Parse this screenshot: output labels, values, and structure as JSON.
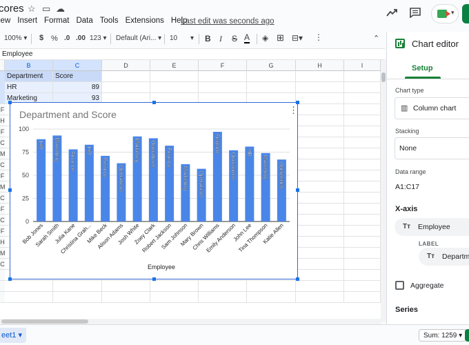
{
  "titlebar": {
    "doc_title": "cores",
    "star_icon": "☆",
    "move_icon": "▭",
    "cloud_icon": "☁"
  },
  "menu": [
    "View",
    "Insert",
    "Format",
    "Data",
    "Tools",
    "Extensions",
    "Help"
  ],
  "menu_first_text": "iew",
  "last_edit": "Last edit was seconds ago",
  "toolbar": {
    "zoom": "100%",
    "currency": "$",
    "percent": "%",
    "dec_decrease": ".0",
    "dec_increase": ".00",
    "number_format": "123",
    "font": "Default (Ari...",
    "font_size": "10",
    "bold": "B",
    "italic": "I",
    "strike": "S",
    "text_color": "A"
  },
  "formula_bar": {
    "content": "Employee"
  },
  "grid": {
    "columns": [
      "B",
      "C",
      "D",
      "E",
      "F",
      "G",
      "H",
      "I"
    ],
    "row_letters": [
      "F",
      "H",
      "F",
      "C",
      "M",
      "C",
      "F",
      "M",
      "C",
      "F",
      "C",
      "F",
      "H",
      "M",
      "C"
    ],
    "rows": [
      {
        "department": "Department",
        "score": "Score"
      },
      {
        "department": "HR",
        "score": "89"
      },
      {
        "department": "Marketing",
        "score": "93"
      }
    ]
  },
  "chart_data": {
    "type": "bar",
    "title": "Department  and Score",
    "xlabel": "Employee",
    "ylabel": "",
    "ylim": [
      0,
      100
    ],
    "yticks": [
      0,
      25,
      50,
      75,
      100
    ],
    "categories": [
      "Bob Jones",
      "Sarah Smith",
      "Julia Kane",
      "Christina Grah...",
      "Mike Beck",
      "Alison Adams",
      "Josh White",
      "Zoey Clark",
      "Robert Jackson",
      "Sam Johnson",
      "Mary Brown",
      "Chris Williams",
      "Emily Anderson",
      "John Lee",
      "Tina Thompson",
      "Katie Allen"
    ],
    "values": [
      89,
      93,
      78,
      83,
      71,
      63,
      92,
      90,
      82,
      62,
      57,
      97,
      77,
      81,
      74,
      67
    ],
    "bar_labels": [
      "HR",
      "Marketing",
      "Finance",
      "HR",
      "Finance",
      "Operations",
      "Marketing",
      "Operations",
      "Finance",
      "Marketing",
      "Operations",
      "Finance",
      "Operations",
      "HR",
      "Marketing",
      "Operations"
    ],
    "bar_color": "#4a86e8",
    "grid": true
  },
  "bottom": {
    "sheet_tab": "eet1 ▾",
    "sum": "Sum: 1259 ▾"
  },
  "panel": {
    "title": "Chart editor",
    "tab": "Setup",
    "chart_type_label": "Chart type",
    "chart_type": "Column chart",
    "stacking_label": "Stacking",
    "stacking": "None",
    "range_label": "Data range",
    "range": "A1:C17",
    "xaxis_label": "X-axis",
    "xaxis_value": "Employee",
    "label_caption": "LABEL",
    "label_value": "Department",
    "aggregate_label": "Aggregate",
    "series_label": "Series"
  },
  "colors": {
    "accent_green": "#188038",
    "selection_blue": "#1a73e8"
  }
}
